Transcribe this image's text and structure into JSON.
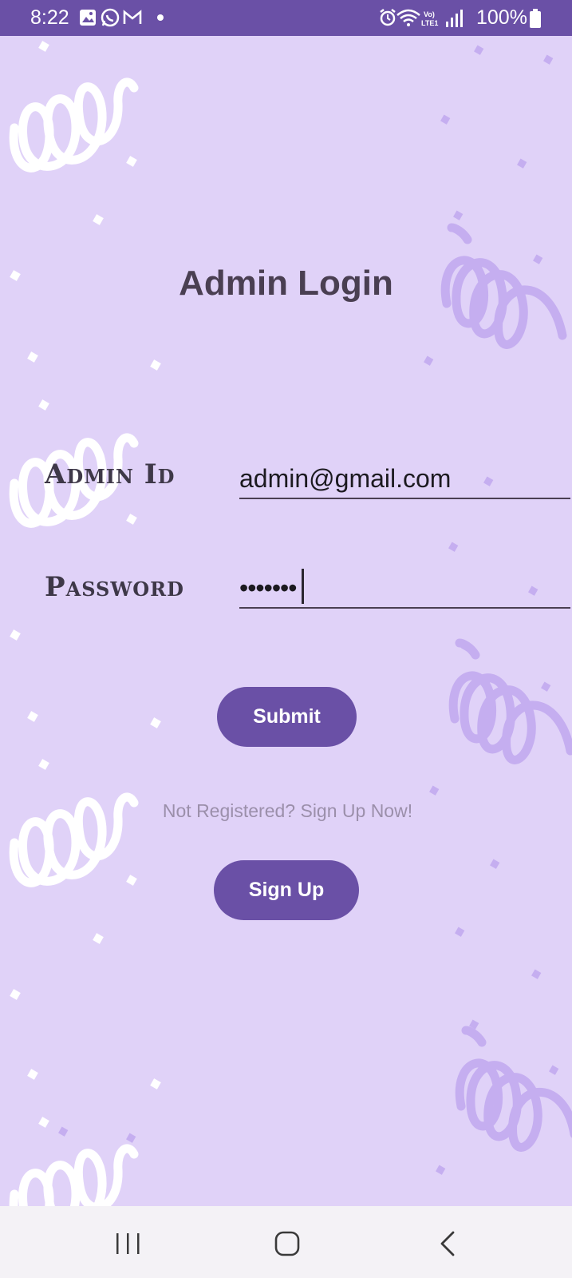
{
  "status_bar": {
    "time": "8:22",
    "battery": "100%",
    "left_icons": [
      "gallery-icon",
      "whatsapp-icon",
      "gmail-icon",
      "dot-icon"
    ],
    "right_icons": [
      "alarm-icon",
      "wifi-icon",
      "volte-icon",
      "signal-icon",
      "battery-icon"
    ]
  },
  "page": {
    "title": "Admin Login"
  },
  "form": {
    "admin_id_label": "Admin Id",
    "admin_id_value": "admin@gmail.com",
    "password_label": "Password",
    "password_value": "•••••••",
    "submit_label": "Submit"
  },
  "signup": {
    "hint": "Not Registered? Sign Up Now!",
    "button_label": "Sign Up"
  },
  "nav_bar": {
    "items": [
      "recents-icon",
      "home-icon",
      "back-icon"
    ]
  },
  "colors": {
    "background": "#e0d2f8",
    "accent": "#6a50a6",
    "title_text": "#4a3f52",
    "hint_text": "#9b8faa"
  }
}
